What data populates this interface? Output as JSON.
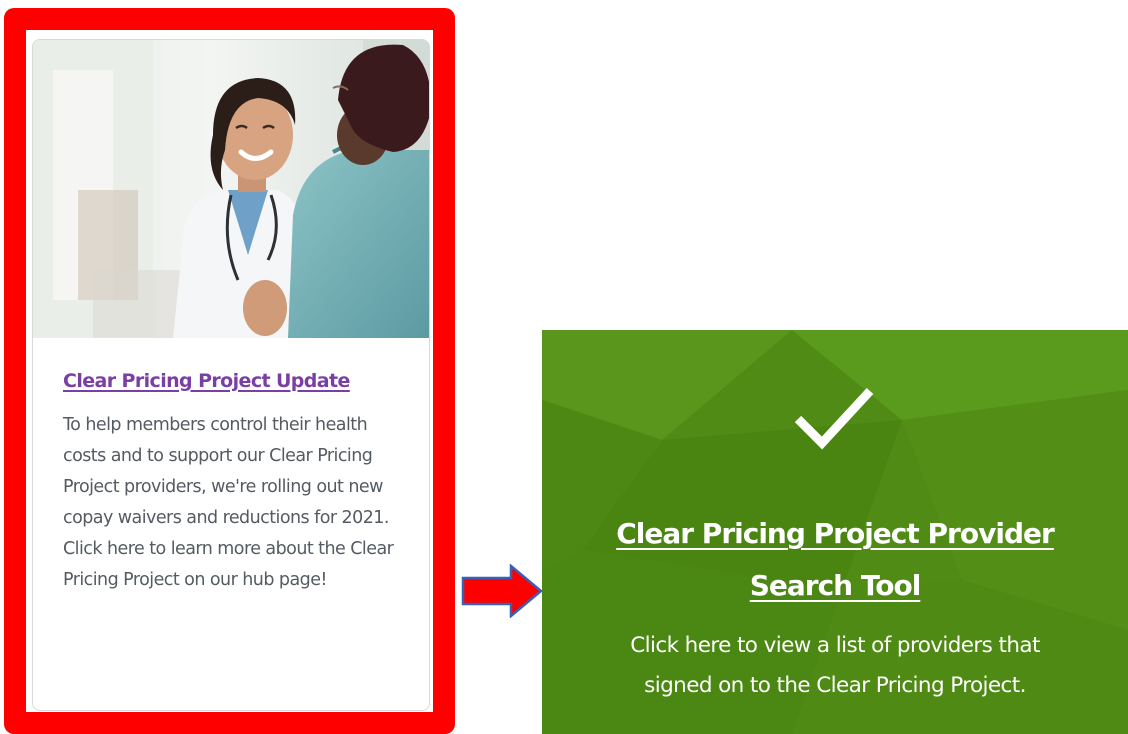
{
  "card": {
    "title": "Clear Pricing Project Update",
    "body": "To help members control their health costs and to support our Clear Pricing Project providers, we're rolling out new copay waivers and reductions for 2021. Click here to learn more about the Clear Pricing Project on our hub page!",
    "photo": "doctor-greeting-patient-photo"
  },
  "tile": {
    "icon": "checkmark-icon",
    "title_line1": "Clear Pricing Project Provider",
    "title_line2": "Search Tool",
    "desc_line1": "Click here to view a list of providers that",
    "desc_line2": "signed on to the Clear Pricing Project."
  },
  "colors": {
    "highlight": "#ff0000",
    "arrow_fill": "#ff0000",
    "arrow_outline": "#3b5fb5",
    "tile_green": "#4d8a14",
    "card_link": "#7a3fa3",
    "card_text": "#555b63"
  }
}
